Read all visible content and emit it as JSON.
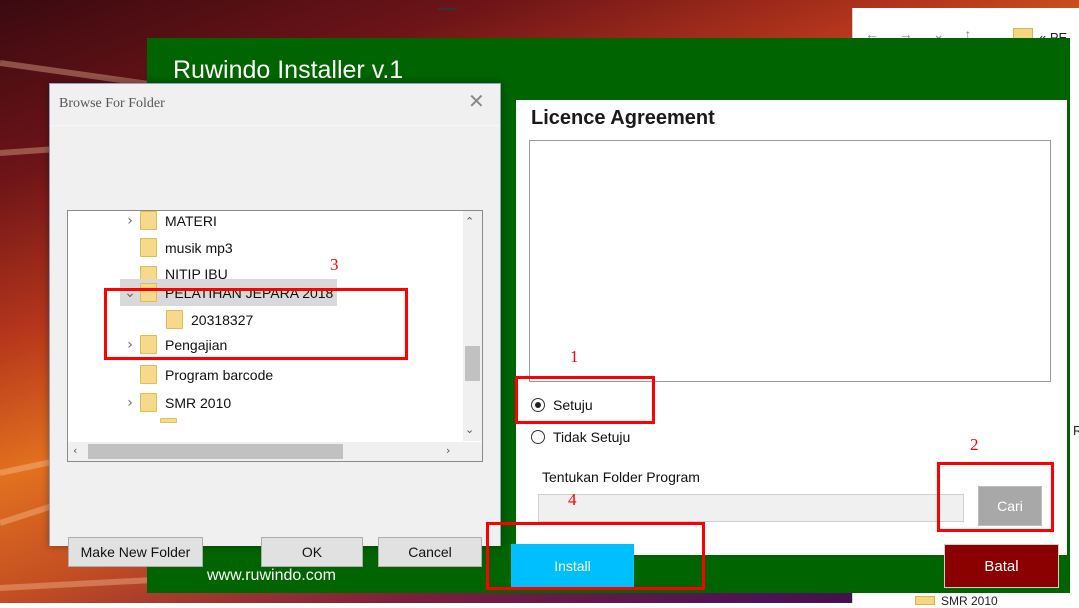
{
  "installer": {
    "title": "Ruwindo Installer v.1",
    "licence_heading": "Licence Agreement",
    "licence_text": "",
    "radio_agree": "Setuju",
    "radio_disagree": "Tidak Setuju",
    "agree_selected": true,
    "folder_label": "Tentukan Folder Program",
    "folder_path": "",
    "browse_button": "Cari",
    "install_button": "Install",
    "cancel_button": "Batal",
    "footer_url": "www.ruwindo.com",
    "colors": {
      "window_bg": "#006400",
      "install_bg": "#00bfff",
      "cancel_bg": "#8b0000",
      "browse_bg": "#a8a8a8"
    }
  },
  "browse_dialog": {
    "title": "Browse For Folder",
    "close_icon": "close-icon",
    "tree": [
      {
        "label": "MATERI",
        "expander": "collapsed"
      },
      {
        "label": "musik mp3",
        "expander": "none"
      },
      {
        "label": "NITIP IBU",
        "expander": "none"
      },
      {
        "label": "PELATIHAN JEPARA 2018",
        "expander": "expanded",
        "selected": true
      },
      {
        "label": "20318327",
        "expander": "none",
        "child": true
      },
      {
        "label": "Pengajian",
        "expander": "collapsed"
      },
      {
        "label": "Program barcode",
        "expander": "none"
      },
      {
        "label": "SMR 2010",
        "expander": "collapsed"
      }
    ],
    "make_new_folder": "Make New Folder",
    "ok": "OK",
    "cancel": "Cancel"
  },
  "annotations": [
    "1",
    "2",
    "3",
    "4"
  ],
  "background_explorer": {
    "path_fragment": "« PE",
    "bottom_item": "SMR 2010",
    "edge_char": "R"
  }
}
